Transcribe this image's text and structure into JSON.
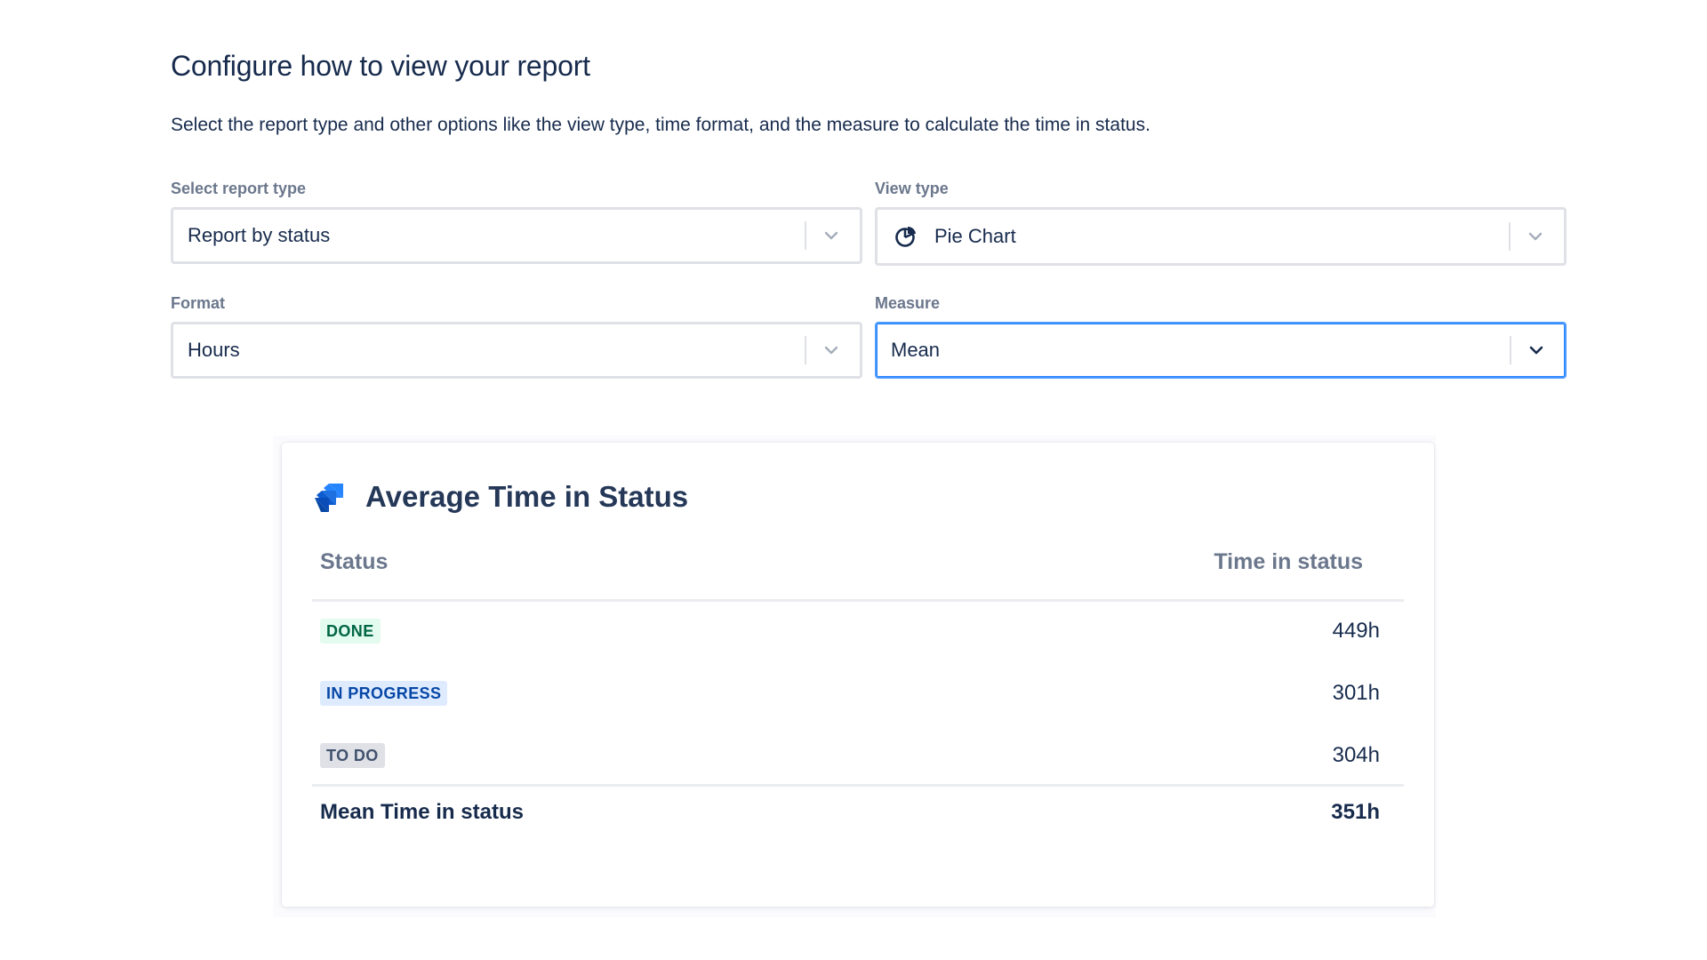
{
  "page": {
    "title": "Configure how to view your report",
    "description": "Select the report type and other options like the view type, time format, and the measure to calculate the time in status."
  },
  "fields": {
    "report_type": {
      "label": "Select report type",
      "value": "Report by status"
    },
    "view_type": {
      "label": "View type",
      "value": "Pie Chart",
      "icon": "pie-chart-icon"
    },
    "format": {
      "label": "Format",
      "value": "Hours"
    },
    "measure": {
      "label": "Measure",
      "value": "Mean",
      "focused": true
    }
  },
  "report": {
    "logo": "jira-logo",
    "title": "Average Time in Status",
    "columns": {
      "status": "Status",
      "time": "Time in status"
    },
    "rows": [
      {
        "status": "DONE",
        "time": "449h"
      },
      {
        "status": "IN PROGRESS",
        "time": "301h"
      },
      {
        "status": "TO DO",
        "time": "304h"
      }
    ],
    "total": {
      "label": "Mean Time in status",
      "value": "351h"
    }
  },
  "colors": {
    "text_primary": "#172B4D",
    "label": "#6B778C",
    "border": "#DFE1E6",
    "focus_border": "#4C9AFF",
    "done_bg": "#E3FCEF",
    "done_text": "#006644",
    "progress_bg": "#DEEBFF",
    "progress_text": "#0747A6",
    "todo_bg": "#DFE1E6",
    "todo_text": "#42526E",
    "logo_blue": "#2684FF"
  }
}
